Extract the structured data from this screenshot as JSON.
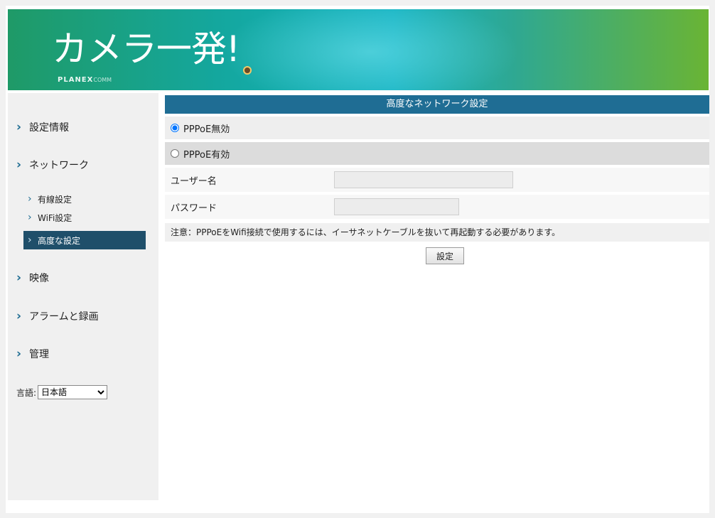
{
  "header": {
    "logo_title": "カメラ一発!",
    "brand": "PLANEX",
    "brand_suffix": "COMM"
  },
  "sidebar": {
    "items": [
      {
        "label": "設定情報"
      },
      {
        "label": "ネットワーク"
      },
      {
        "label": "映像"
      },
      {
        "label": "アラームと録画"
      },
      {
        "label": "管理"
      }
    ],
    "network_subitems": [
      {
        "label": "有線設定"
      },
      {
        "label": "WiFi設定"
      },
      {
        "label": "高度な設定"
      }
    ],
    "language_label": "言語:",
    "language_value": "日本語"
  },
  "main": {
    "title": "高度なネットワーク設定",
    "pppoe_disabled_label": "PPPoE無効",
    "pppoe_enabled_label": "PPPoE有効",
    "pppoe_selected": "disabled",
    "username_label": "ユーザー名",
    "username_value": "",
    "password_label": "パスワード",
    "password_value": "",
    "notice": "注意：PPPoEをWifi接続で使用するには、イーサネットケーブルを抜いて再起動する必要があります。",
    "submit_label": "設定"
  },
  "colors": {
    "panel_header": "#1f6d94",
    "active_nav": "#1f4f6a",
    "chevron": "#1f6d92"
  }
}
